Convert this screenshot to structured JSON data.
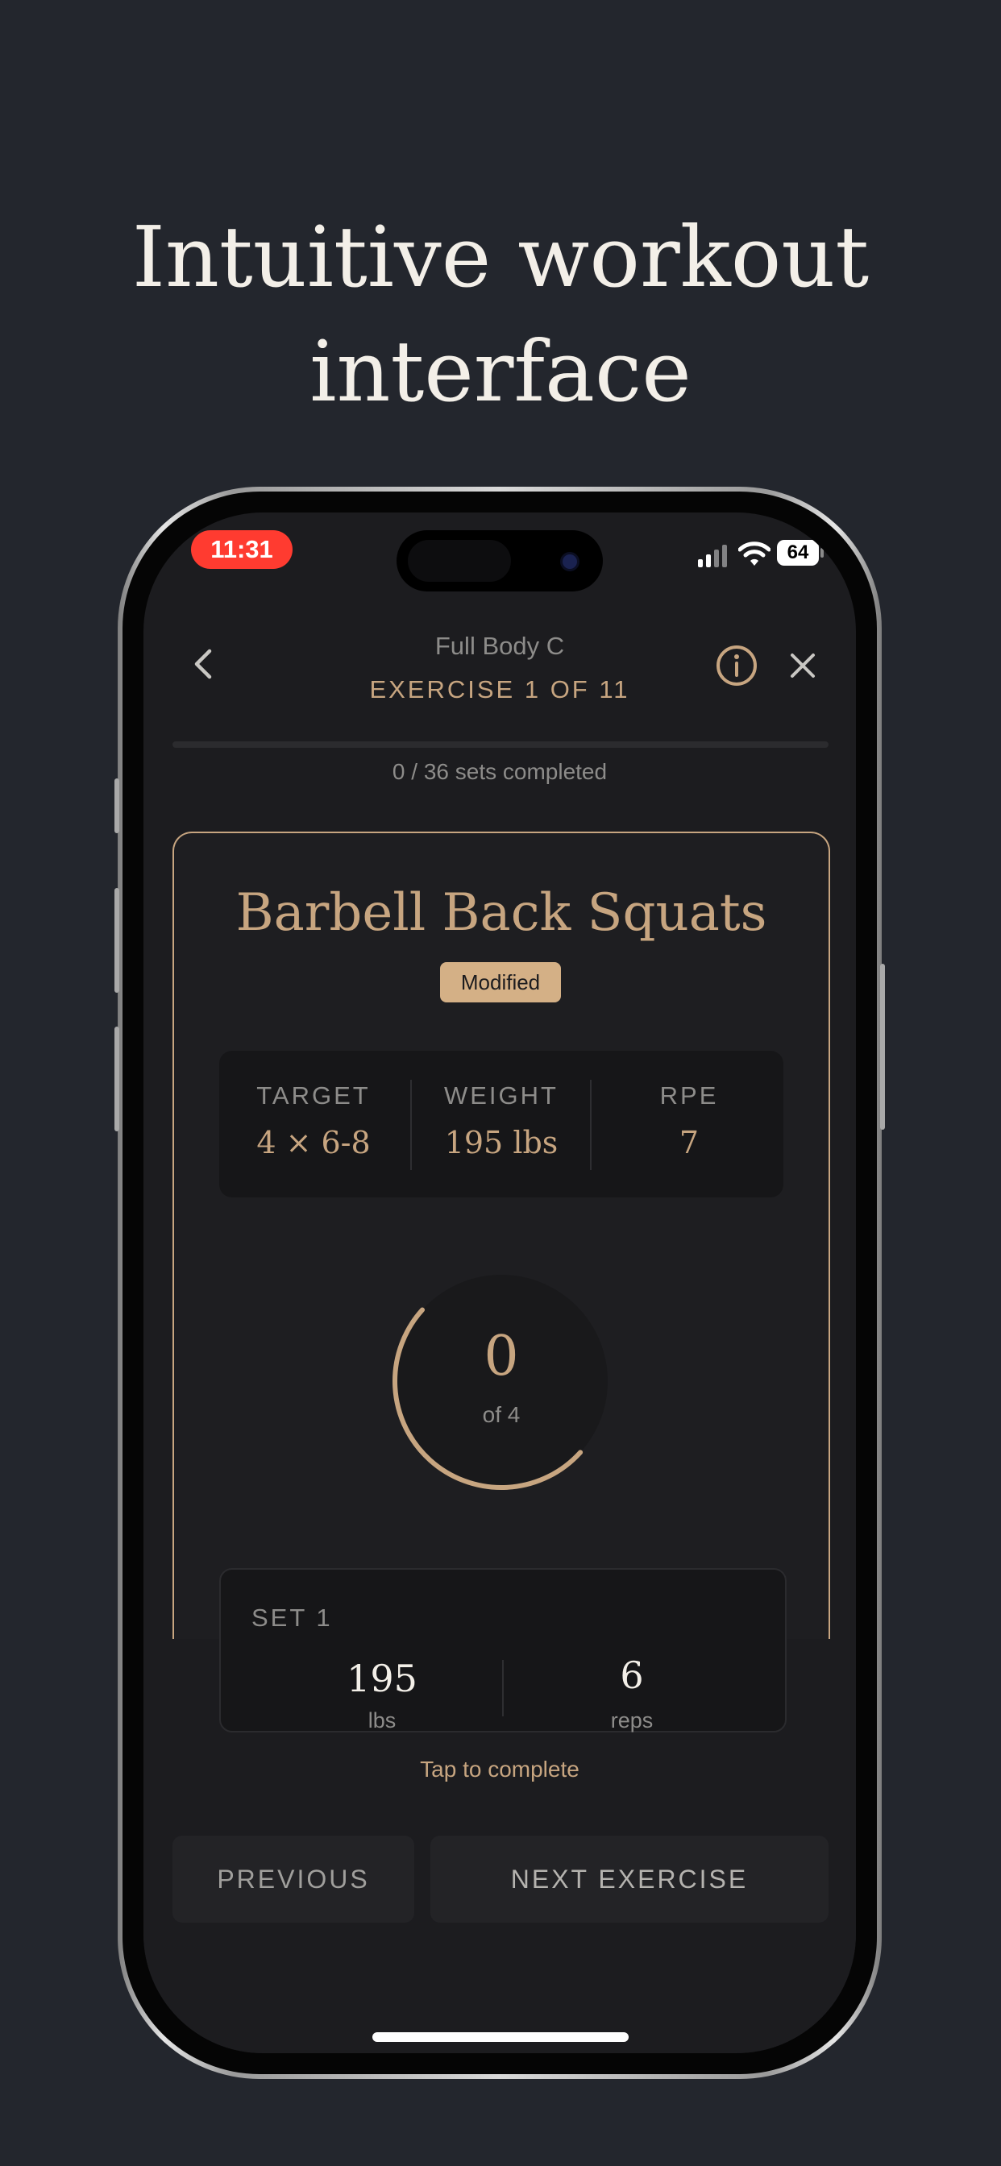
{
  "headline": {
    "line1": "Intuitive workout",
    "line2": "interface"
  },
  "status_bar": {
    "time": "11:31",
    "battery": "64",
    "icons": [
      "cellular-signal-icon",
      "wifi-icon",
      "battery-icon"
    ]
  },
  "header": {
    "workout_name": "Full Body C",
    "exercise_index": "EXERCISE 1 OF 11",
    "icons": [
      "chevron-left-icon",
      "info-icon",
      "close-icon"
    ]
  },
  "progress": {
    "completed_sets": 0,
    "total_sets": 36,
    "label": "0 / 36 sets completed"
  },
  "exercise": {
    "name": "Barbell Back Squats",
    "badge": "Modified",
    "stats": [
      {
        "label": "TARGET",
        "value": "4 × 6-8"
      },
      {
        "label": "WEIGHT",
        "value": "195 lbs"
      },
      {
        "label": "RPE",
        "value": "7"
      }
    ],
    "sets_done": "0",
    "sets_total_label": "of 4",
    "ring_fill_fraction": 0.5
  },
  "current_set": {
    "label": "SET 1",
    "weight": "195",
    "weight_unit": "lbs",
    "reps": "6",
    "reps_unit": "reps",
    "action": "Tap to complete"
  },
  "footer": {
    "previous_label": "PREVIOUS",
    "next_label": "NEXT EXERCISE"
  },
  "colors": {
    "accent": "#c7a580",
    "background": "#23262d",
    "screen": "#1c1c1f",
    "status_time": "#ff3b30"
  }
}
